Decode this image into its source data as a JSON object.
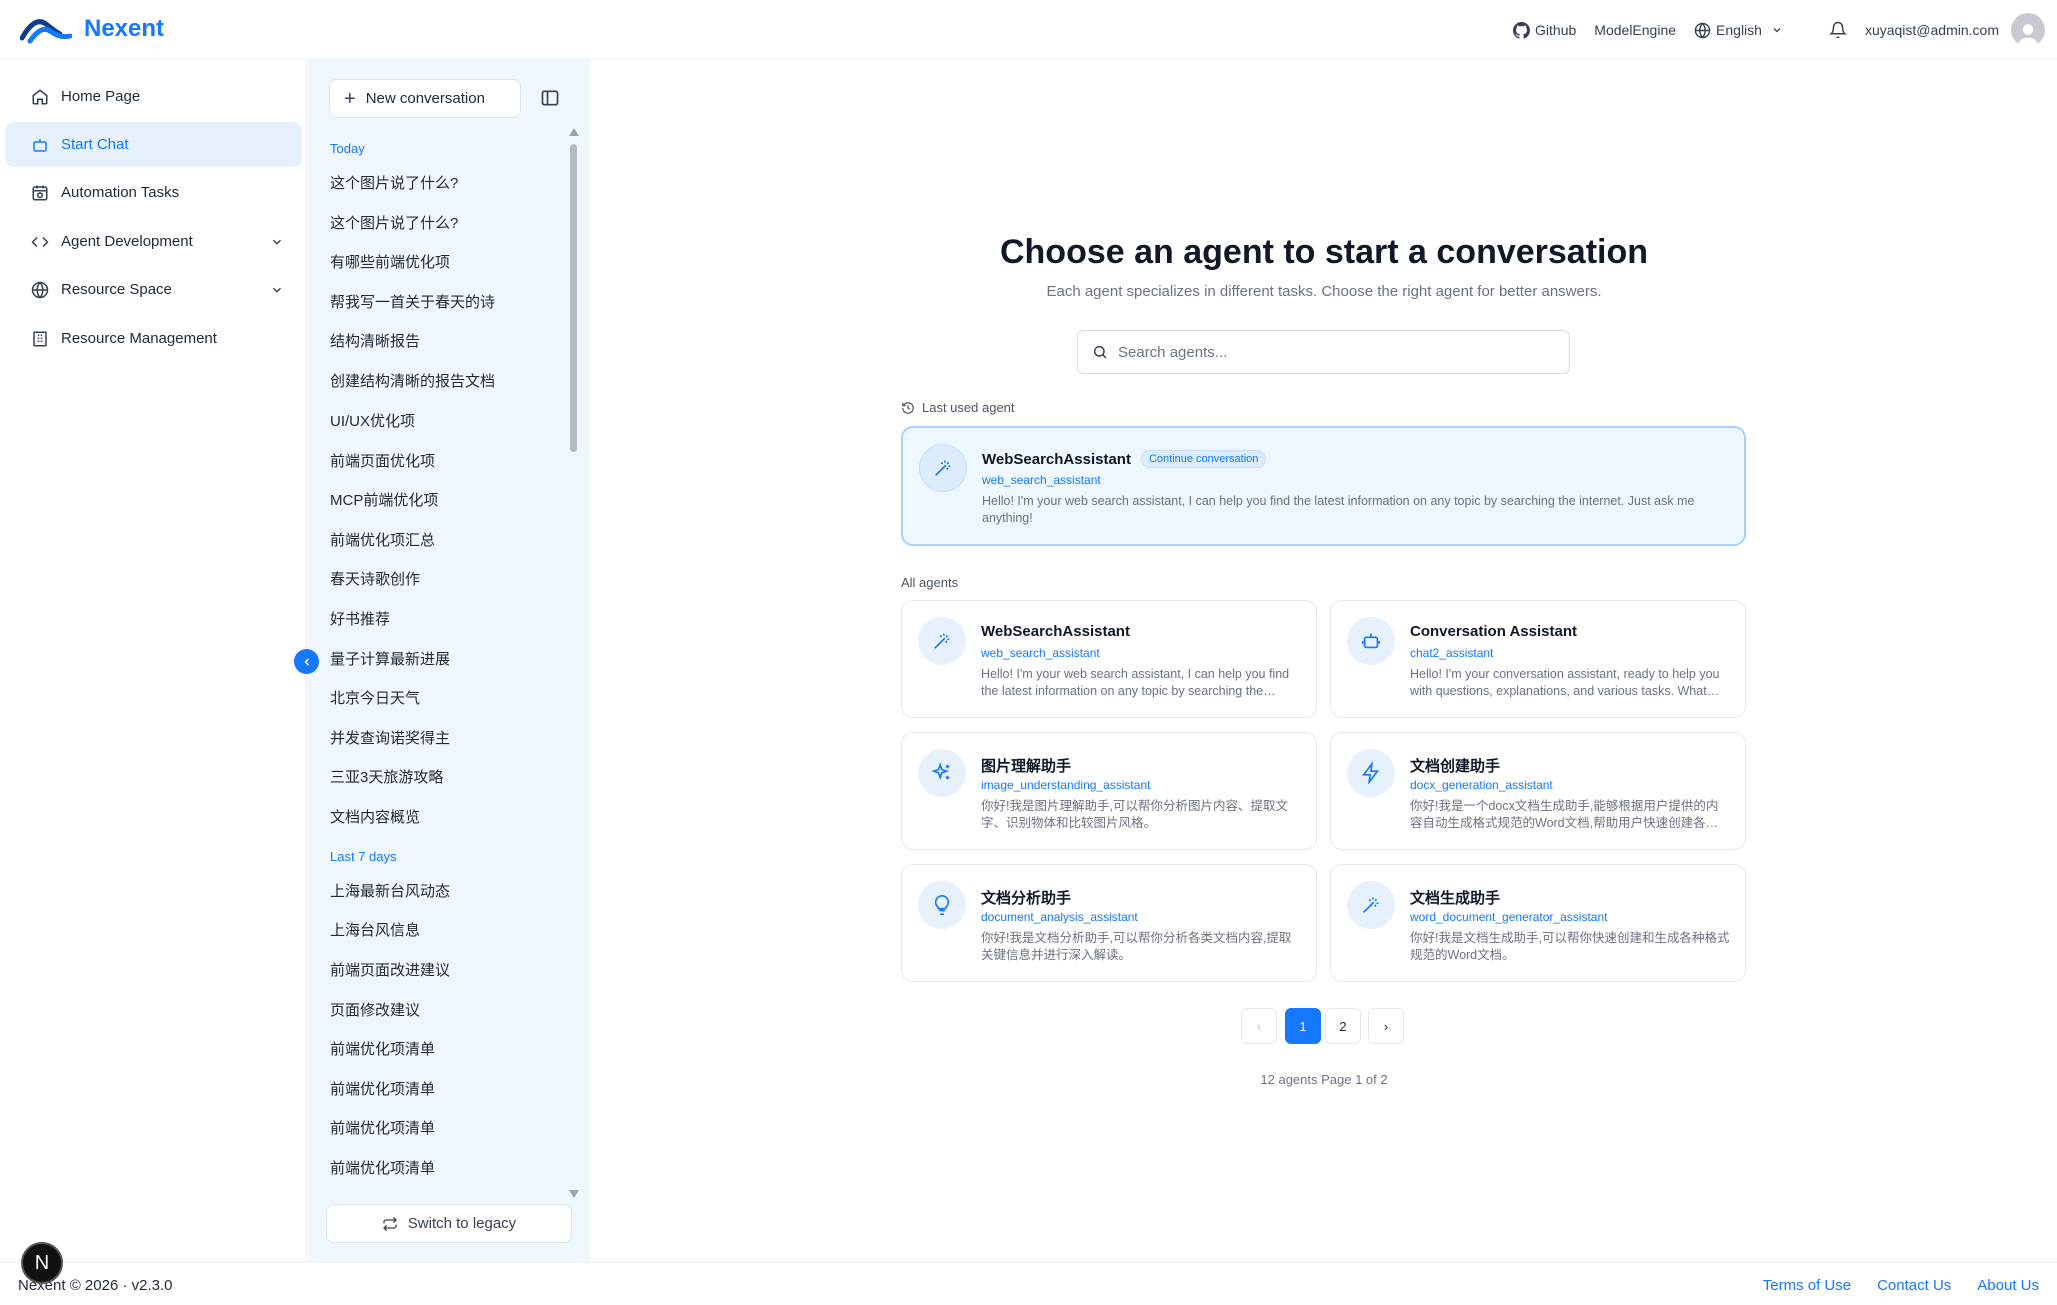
{
  "app": {
    "name": "Nexent",
    "brand_color": "#1677ff"
  },
  "header": {
    "github_label": "Github",
    "modelengine_label": "ModelEngine",
    "language_label": "English",
    "user_email": "xuyaqist@admin.com"
  },
  "sidebar": {
    "items": [
      {
        "label": "Home Page",
        "icon": "home-icon"
      },
      {
        "label": "Start Chat",
        "icon": "bot-icon",
        "active": true
      },
      {
        "label": "Automation Tasks",
        "icon": "calendar-clock-icon"
      },
      {
        "label": "Agent Development",
        "icon": "code-icon",
        "expandable": true
      },
      {
        "label": "Resource Space",
        "icon": "globe-icon",
        "expandable": true
      },
      {
        "label": "Resource Management",
        "icon": "building-icon"
      }
    ]
  },
  "conversations": {
    "new_label": "New conversation",
    "groups": [
      {
        "title": "Today",
        "items": [
          "这个图片说了什么?",
          "这个图片说了什么?",
          "有哪些前端优化项",
          "帮我写一首关于春天的诗",
          "结构清晰报告",
          "创建结构清晰的报告文档",
          "UI/UX优化项",
          "前端页面优化项",
          "MCP前端优化项",
          "前端优化项汇总",
          "春天诗歌创作",
          "好书推荐",
          "量子计算最新进展",
          "北京今日天气",
          "并发查询诺奖得主",
          "三亚3天旅游攻略",
          "文档内容概览"
        ]
      },
      {
        "title": "Last 7 days",
        "items": [
          "上海最新台风动态",
          "上海台风信息",
          "前端页面改进建议",
          "页面修改建议",
          "前端优化项清单",
          "前端优化项清单",
          "前端优化项清单",
          "前端优化项清单"
        ]
      }
    ],
    "switch_legacy_label": "Switch to legacy"
  },
  "main": {
    "title": "Choose an agent to start a conversation",
    "subtitle": "Each agent specializes in different tasks. Choose the right agent for better answers.",
    "search_placeholder": "Search agents...",
    "last_used_label": "Last used agent",
    "all_agents_label": "All agents",
    "last_used": {
      "name": "WebSearchAssistant",
      "badge": "Continue conversation",
      "id": "web_search_assistant",
      "desc": "Hello! I'm your web search assistant, I can help you find the latest information on any topic by searching the internet. Just ask me anything!",
      "icon": "magic-wand-icon"
    },
    "agents": [
      {
        "name": "WebSearchAssistant",
        "id": "web_search_assistant",
        "desc": "Hello! I'm your web search assistant, I can help you find the latest information on any topic by searching the internet. Just ask me anything!",
        "icon": "magic-wand-icon"
      },
      {
        "name": "Conversation Assistant",
        "id": "chat2_assistant",
        "desc": "Hello! I'm your conversation assistant, ready to help you with questions, explanations, and various tasks. What would you like to talk about?",
        "icon": "bot-icon"
      },
      {
        "name": "图片理解助手",
        "id": "image_understanding_assistant",
        "desc": "你好!我是图片理解助手,可以帮你分析图片内容、提取文字、识别物体和比较图片风格。",
        "icon": "sparkles-icon"
      },
      {
        "name": "文档创建助手",
        "id": "docx_generation_assistant",
        "desc": "你好!我是一个docx文档生成助手,能够根据用户提供的内容自动生成格式规范的Word文档,帮助用户快速创建各类专业文档。",
        "icon": "lightning-icon"
      },
      {
        "name": "文档分析助手",
        "id": "document_analysis_assistant",
        "desc": "你好!我是文档分析助手,可以帮你分析各类文档内容,提取关键信息并进行深入解读。",
        "icon": "lightbulb-icon"
      },
      {
        "name": "文档生成助手",
        "id": "word_document_generator_assistant",
        "desc": "你好!我是文档生成助手,可以帮你快速创建和生成各种格式规范的Word文档。",
        "icon": "magic-wand-icon"
      }
    ],
    "pagination": {
      "prev": "‹",
      "pages": [
        "1",
        "2"
      ],
      "current": "1",
      "next": "›",
      "info": "12 agents Page 1 of 2"
    }
  },
  "footer": {
    "copyright": "Nexent © 2026 · v2.3.0",
    "links": [
      "Terms of Use",
      "Contact Us",
      "About Us"
    ]
  }
}
